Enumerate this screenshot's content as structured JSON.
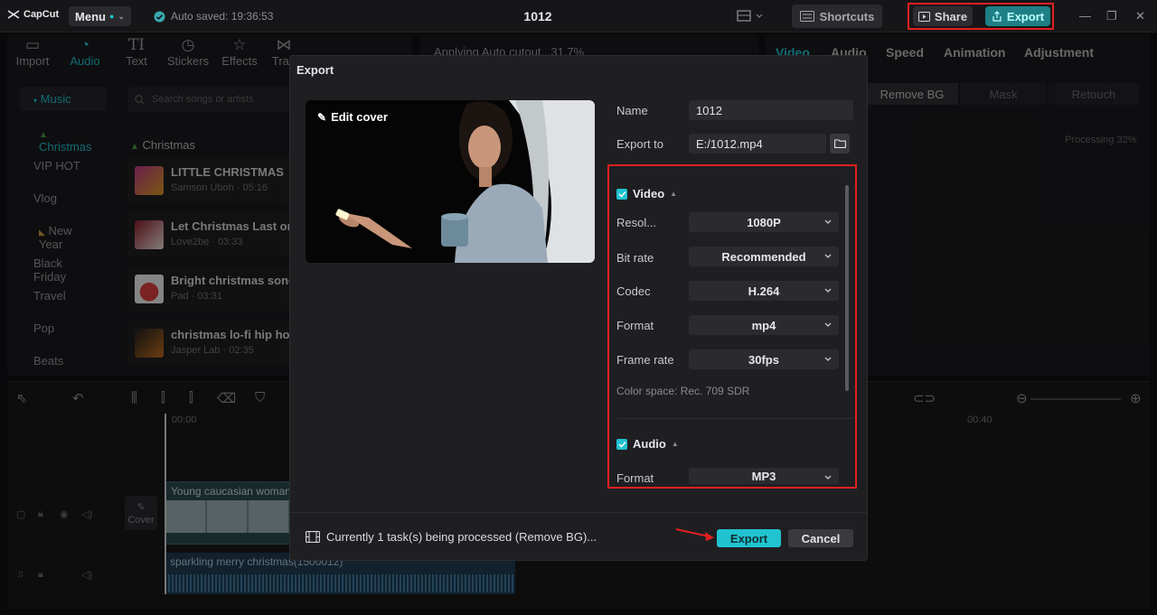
{
  "app": {
    "logo": "CapCut",
    "menu_label": "Menu",
    "autosave": "Auto saved: 19:36:53",
    "project_title": "1012",
    "shortcuts_label": "Shortcuts",
    "share_label": "Share",
    "export_label": "Export"
  },
  "toolbar": {
    "tabs": [
      {
        "label": "Import",
        "icon": "import-icon"
      },
      {
        "label": "Audio",
        "icon": "audio-icon"
      },
      {
        "label": "Text",
        "icon": "text-icon"
      },
      {
        "label": "Stickers",
        "icon": "stickers-icon"
      },
      {
        "label": "Effects",
        "icon": "effects-icon"
      },
      {
        "label": "Tran",
        "icon": "transitions-icon"
      }
    ]
  },
  "sidebar": {
    "categories": [
      "Music",
      "Christmas",
      "VIP HOT",
      "Vlog",
      "New Year",
      "Black Friday",
      "Travel",
      "Pop",
      "Beats"
    ]
  },
  "music": {
    "search_placeholder": "Search songs or artists",
    "section_label": "Christmas",
    "songs": [
      {
        "title": "LITTLE CHRISTMAS",
        "meta": "Samson Uboh · 05:16"
      },
      {
        "title": "Let Christmas Last on",
        "meta": "Love2be · 03:33"
      },
      {
        "title": "Bright christmas song",
        "meta": "Pad · 03:31"
      },
      {
        "title": "christmas lo-fi hip hop",
        "meta": "Jasper Lab · 02:35"
      }
    ]
  },
  "preview": {
    "cutout_status": "Applying Auto cutout...31.7%"
  },
  "right_panel": {
    "tabs": [
      "Video",
      "Audio",
      "Speed",
      "Animation",
      "Adjustment"
    ],
    "segments": [
      "Remove BG",
      "Mask",
      "Retouch"
    ],
    "processing": "Processing 32%"
  },
  "timeline": {
    "time_start": "00:00",
    "time_end": "00:40",
    "cover_label": "Cover",
    "video_clip_label": "Young caucasian woman",
    "audio_clip_label": "sparkling merry christmas(1500012)"
  },
  "export_dialog": {
    "title": "Export",
    "edit_cover_label": "Edit cover",
    "name_label": "Name",
    "name_value": "1012",
    "export_to_label": "Export to",
    "export_to_value": "E:/1012.mp4",
    "video_section": "Video",
    "resolution_label": "Resol...",
    "resolution_value": "1080P",
    "bitrate_label": "Bit rate",
    "bitrate_value": "Recommended",
    "codec_label": "Codec",
    "codec_value": "H.264",
    "format_label": "Format",
    "format_value": "mp4",
    "framerate_label": "Frame rate",
    "framerate_value": "30fps",
    "color_space": "Color space: Rec. 709 SDR",
    "audio_section": "Audio",
    "audio_format_label": "Format",
    "audio_format_value": "MP3",
    "task_status": "Currently 1 task(s) being processed (Remove BG)...",
    "export_button": "Export",
    "cancel_button": "Cancel"
  },
  "colors": {
    "accent": "#21c3d0",
    "highlight": "#e02020",
    "background": "#121214"
  }
}
